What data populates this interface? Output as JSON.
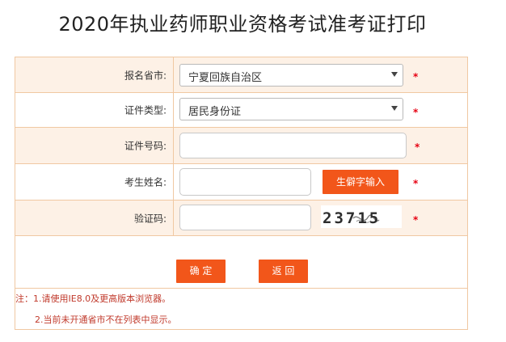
{
  "page": {
    "title": "2020年执业药师职业资格考试准考证打印"
  },
  "form": {
    "province": {
      "label": "报名省市:",
      "selected": "宁夏回族自治区",
      "required_mark": "*"
    },
    "id_type": {
      "label": "证件类型:",
      "selected": "居民身份证",
      "required_mark": "*"
    },
    "id_number": {
      "label": "证件号码:",
      "value": "",
      "required_mark": "*"
    },
    "name": {
      "label": "考生姓名:",
      "value": "",
      "rare_char_button": "生僻字输入",
      "required_mark": "*"
    },
    "captcha": {
      "label": "验证码:",
      "value": "",
      "image_text": "23715",
      "required_mark": "*"
    }
  },
  "buttons": {
    "confirm": "确 定",
    "back": "返 回"
  },
  "notes": {
    "line1": "注：1.请使用IE8.0及更高版本浏览器。",
    "line2": "2.当前未开通省市不在列表中显示。"
  },
  "colors": {
    "accent": "#f2561a",
    "border": "#f0c8a2",
    "shaded_row": "#fdf1e6",
    "required": "#e60012",
    "note_text": "#c0392b"
  }
}
